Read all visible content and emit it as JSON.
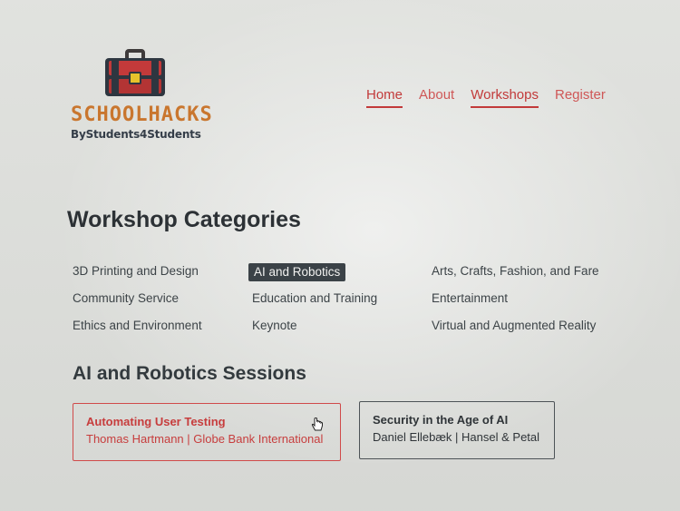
{
  "logo": {
    "wordmark": "SCHOOLHACKS",
    "tagline": "ByStudents4Students",
    "icon": "toolbox-icon"
  },
  "nav": {
    "items": [
      {
        "label": "Home",
        "active": true
      },
      {
        "label": "About",
        "active": false
      },
      {
        "label": "Workshops",
        "active": true
      },
      {
        "label": "Register",
        "active": false
      }
    ]
  },
  "categories": {
    "title": "Workshop Categories",
    "items": [
      {
        "label": "3D Printing and Design"
      },
      {
        "label": "AI and Robotics",
        "selected": true
      },
      {
        "label": "Arts, Crafts, Fashion, and Fare"
      },
      {
        "label": "Community Service"
      },
      {
        "label": "Education and Training"
      },
      {
        "label": "Entertainment"
      },
      {
        "label": "Ethics and Environment"
      },
      {
        "label": "Keynote"
      },
      {
        "label": "Virtual and Augmented Reality"
      }
    ]
  },
  "sessions": {
    "title": "AI and Robotics Sessions",
    "cards": [
      {
        "title": "Automating User Testing",
        "meta": "Thomas Hartmann | Globe Bank International"
      },
      {
        "title": "Security in the Age of AI",
        "meta": "Daniel Ellebæk | Hansel & Petal"
      }
    ]
  },
  "colors": {
    "accent": "#c23a3a",
    "text": "#2f3336",
    "selected_pill": "#3b4247",
    "logo_orange": "#c9762e"
  }
}
